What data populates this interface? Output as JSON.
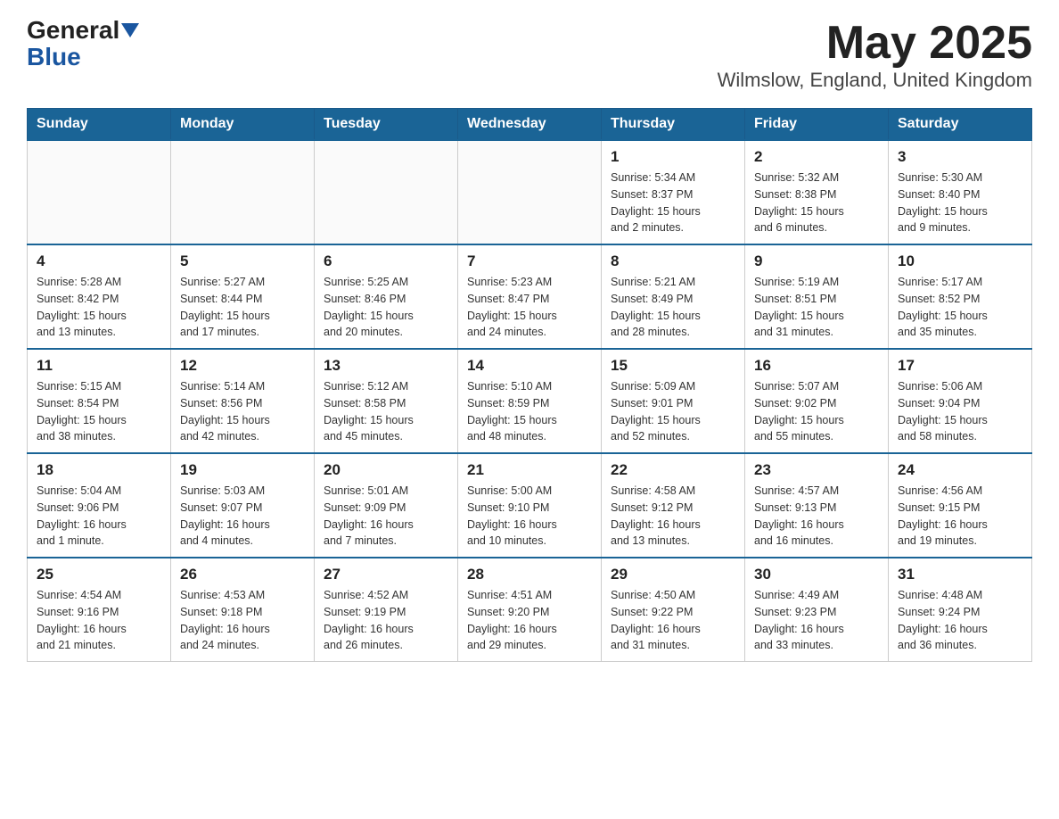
{
  "header": {
    "logo_general": "General",
    "logo_blue": "Blue",
    "title": "May 2025",
    "location": "Wilmslow, England, United Kingdom"
  },
  "days_of_week": [
    "Sunday",
    "Monday",
    "Tuesday",
    "Wednesday",
    "Thursday",
    "Friday",
    "Saturday"
  ],
  "weeks": [
    [
      {
        "day": "",
        "info": ""
      },
      {
        "day": "",
        "info": ""
      },
      {
        "day": "",
        "info": ""
      },
      {
        "day": "",
        "info": ""
      },
      {
        "day": "1",
        "info": "Sunrise: 5:34 AM\nSunset: 8:37 PM\nDaylight: 15 hours\nand 2 minutes."
      },
      {
        "day": "2",
        "info": "Sunrise: 5:32 AM\nSunset: 8:38 PM\nDaylight: 15 hours\nand 6 minutes."
      },
      {
        "day": "3",
        "info": "Sunrise: 5:30 AM\nSunset: 8:40 PM\nDaylight: 15 hours\nand 9 minutes."
      }
    ],
    [
      {
        "day": "4",
        "info": "Sunrise: 5:28 AM\nSunset: 8:42 PM\nDaylight: 15 hours\nand 13 minutes."
      },
      {
        "day": "5",
        "info": "Sunrise: 5:27 AM\nSunset: 8:44 PM\nDaylight: 15 hours\nand 17 minutes."
      },
      {
        "day": "6",
        "info": "Sunrise: 5:25 AM\nSunset: 8:46 PM\nDaylight: 15 hours\nand 20 minutes."
      },
      {
        "day": "7",
        "info": "Sunrise: 5:23 AM\nSunset: 8:47 PM\nDaylight: 15 hours\nand 24 minutes."
      },
      {
        "day": "8",
        "info": "Sunrise: 5:21 AM\nSunset: 8:49 PM\nDaylight: 15 hours\nand 28 minutes."
      },
      {
        "day": "9",
        "info": "Sunrise: 5:19 AM\nSunset: 8:51 PM\nDaylight: 15 hours\nand 31 minutes."
      },
      {
        "day": "10",
        "info": "Sunrise: 5:17 AM\nSunset: 8:52 PM\nDaylight: 15 hours\nand 35 minutes."
      }
    ],
    [
      {
        "day": "11",
        "info": "Sunrise: 5:15 AM\nSunset: 8:54 PM\nDaylight: 15 hours\nand 38 minutes."
      },
      {
        "day": "12",
        "info": "Sunrise: 5:14 AM\nSunset: 8:56 PM\nDaylight: 15 hours\nand 42 minutes."
      },
      {
        "day": "13",
        "info": "Sunrise: 5:12 AM\nSunset: 8:58 PM\nDaylight: 15 hours\nand 45 minutes."
      },
      {
        "day": "14",
        "info": "Sunrise: 5:10 AM\nSunset: 8:59 PM\nDaylight: 15 hours\nand 48 minutes."
      },
      {
        "day": "15",
        "info": "Sunrise: 5:09 AM\nSunset: 9:01 PM\nDaylight: 15 hours\nand 52 minutes."
      },
      {
        "day": "16",
        "info": "Sunrise: 5:07 AM\nSunset: 9:02 PM\nDaylight: 15 hours\nand 55 minutes."
      },
      {
        "day": "17",
        "info": "Sunrise: 5:06 AM\nSunset: 9:04 PM\nDaylight: 15 hours\nand 58 minutes."
      }
    ],
    [
      {
        "day": "18",
        "info": "Sunrise: 5:04 AM\nSunset: 9:06 PM\nDaylight: 16 hours\nand 1 minute."
      },
      {
        "day": "19",
        "info": "Sunrise: 5:03 AM\nSunset: 9:07 PM\nDaylight: 16 hours\nand 4 minutes."
      },
      {
        "day": "20",
        "info": "Sunrise: 5:01 AM\nSunset: 9:09 PM\nDaylight: 16 hours\nand 7 minutes."
      },
      {
        "day": "21",
        "info": "Sunrise: 5:00 AM\nSunset: 9:10 PM\nDaylight: 16 hours\nand 10 minutes."
      },
      {
        "day": "22",
        "info": "Sunrise: 4:58 AM\nSunset: 9:12 PM\nDaylight: 16 hours\nand 13 minutes."
      },
      {
        "day": "23",
        "info": "Sunrise: 4:57 AM\nSunset: 9:13 PM\nDaylight: 16 hours\nand 16 minutes."
      },
      {
        "day": "24",
        "info": "Sunrise: 4:56 AM\nSunset: 9:15 PM\nDaylight: 16 hours\nand 19 minutes."
      }
    ],
    [
      {
        "day": "25",
        "info": "Sunrise: 4:54 AM\nSunset: 9:16 PM\nDaylight: 16 hours\nand 21 minutes."
      },
      {
        "day": "26",
        "info": "Sunrise: 4:53 AM\nSunset: 9:18 PM\nDaylight: 16 hours\nand 24 minutes."
      },
      {
        "day": "27",
        "info": "Sunrise: 4:52 AM\nSunset: 9:19 PM\nDaylight: 16 hours\nand 26 minutes."
      },
      {
        "day": "28",
        "info": "Sunrise: 4:51 AM\nSunset: 9:20 PM\nDaylight: 16 hours\nand 29 minutes."
      },
      {
        "day": "29",
        "info": "Sunrise: 4:50 AM\nSunset: 9:22 PM\nDaylight: 16 hours\nand 31 minutes."
      },
      {
        "day": "30",
        "info": "Sunrise: 4:49 AM\nSunset: 9:23 PM\nDaylight: 16 hours\nand 33 minutes."
      },
      {
        "day": "31",
        "info": "Sunrise: 4:48 AM\nSunset: 9:24 PM\nDaylight: 16 hours\nand 36 minutes."
      }
    ]
  ]
}
